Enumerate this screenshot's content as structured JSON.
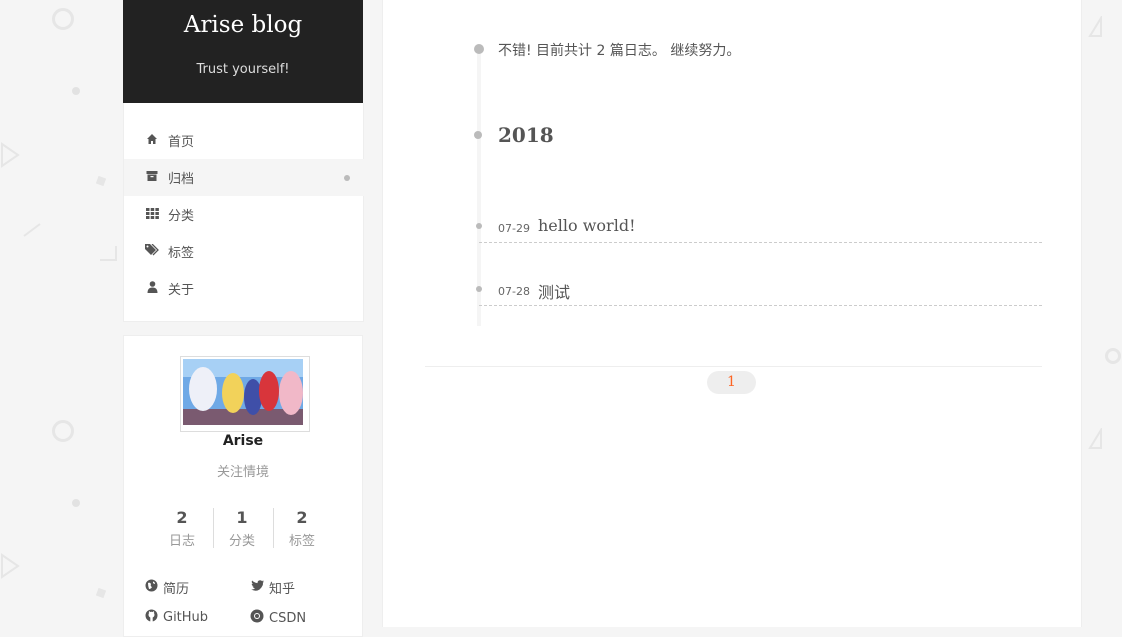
{
  "site": {
    "title": "Arise blog",
    "subtitle": "Trust yourself!"
  },
  "menu": {
    "items": [
      {
        "label": "首页",
        "icon": "home-icon"
      },
      {
        "label": "归档",
        "icon": "archive-icon",
        "active": true
      },
      {
        "label": "分类",
        "icon": "grid-icon"
      },
      {
        "label": "标签",
        "icon": "tags-icon"
      },
      {
        "label": "关于",
        "icon": "user-icon"
      }
    ]
  },
  "author": {
    "name": "Arise",
    "description": "关注情境",
    "stats": [
      {
        "count": "2",
        "label": "日志"
      },
      {
        "count": "1",
        "label": "分类"
      },
      {
        "count": "2",
        "label": "标签"
      }
    ],
    "links": [
      {
        "label": "简历",
        "icon": "globe-icon"
      },
      {
        "label": "知乎",
        "icon": "twitter-icon"
      },
      {
        "label": "GitHub",
        "icon": "github-icon"
      },
      {
        "label": "CSDN",
        "icon": "chrome-icon"
      }
    ]
  },
  "archive": {
    "note": "不错! 目前共计 2 篇日志。 继续努力。",
    "year": "2018",
    "posts": [
      {
        "date": "07-29",
        "title": "hello world!"
      },
      {
        "date": "07-28",
        "title": "测试"
      }
    ]
  },
  "pagination": {
    "current": "1"
  },
  "colors": {
    "brand_bg": "#222222",
    "page_accent": "#fc6423",
    "timeline": "#bbbbbb"
  }
}
